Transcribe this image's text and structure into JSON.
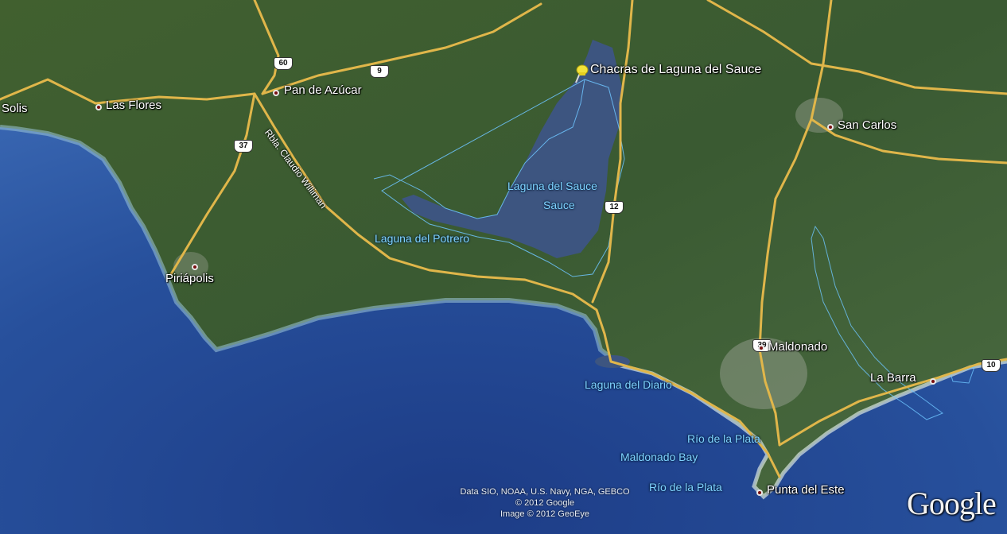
{
  "places": {
    "solis": "Solis",
    "las_flores": "Las Flores",
    "pan_de_azucar": "Pan de Azúcar",
    "chacras": "Chacras de Laguna del Sauce",
    "san_carlos": "San Carlos",
    "piriapolis": "Piriápolis",
    "maldonado": "Maldonado",
    "la_barra": "La Barra",
    "punta_del_este": "Punta del Este"
  },
  "water_labels": {
    "laguna_del_sauce": "Laguna del Sauce",
    "sauce": "Sauce",
    "laguna_del_potrero": "Laguna del Potrero",
    "laguna_del_diario": "Laguna del Diario",
    "rio_de_la_plata_1": "Río de la Plata",
    "maldonado_bay": "Maldonado Bay",
    "rio_de_la_plata_2": "Río de la Plata"
  },
  "road_shields": {
    "r60": "60",
    "r9": "9",
    "r37": "37",
    "r12": "12",
    "r39": "39",
    "r10": "10"
  },
  "road_names": {
    "rambla": "Rbla. Claudio Williman"
  },
  "attribution": {
    "line1": "Data SIO, NOAA, U.S. Navy, NGA, GEBCO",
    "line2": "© 2012 Google",
    "line3": "Image © 2012 GeoEye"
  },
  "logo": "Google",
  "icons": {
    "placemark": "yellow-pushpin-icon"
  },
  "colors": {
    "ocean_deep": "#1e3f88",
    "ocean_shallow": "#4d7ac0",
    "land": "#3f5f35",
    "road": "#e0b64a",
    "water_label": "#7fd2ff",
    "water_outline": "#6ec6ff"
  }
}
